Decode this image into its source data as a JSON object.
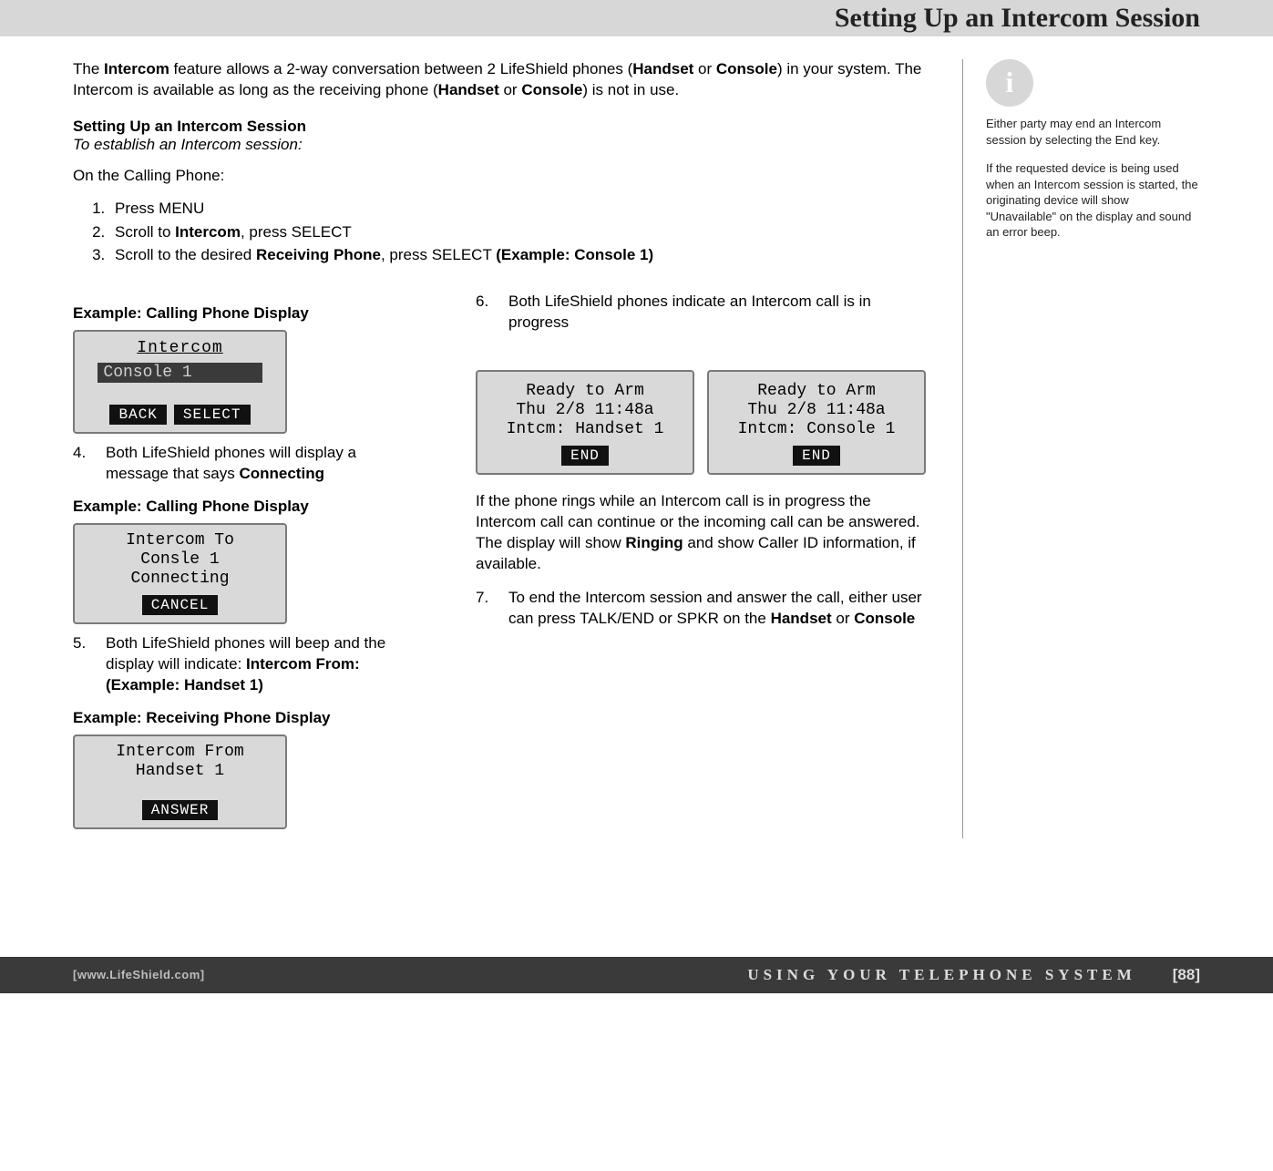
{
  "header": {
    "title": "Setting Up an Intercom Session"
  },
  "intro": {
    "part1": "The ",
    "b1": "Intercom",
    "part2": " feature allows a 2-way conversation between 2 LifeShield phones (",
    "b2": "Handset",
    "part3": " or ",
    "b3": "Console",
    "part4": ") in your system. The Intercom is available as long as the receiving phone (",
    "b4": "Handset",
    "part5": " or ",
    "b5": "Console",
    "part6": ") is not in use."
  },
  "subhead": "Setting Up an Intercom Session",
  "subhead_em": "To establish an Intercom session:",
  "on_calling": "On the Calling Phone:",
  "steps123": {
    "s1": "Press MENU",
    "s2a": "Scroll to ",
    "s2b": "Intercom",
    "s2c": ", press SELECT",
    "s3a": "Scroll to the desired ",
    "s3b": "Receiving Phone",
    "s3c": ", press SELECT ",
    "s3d": "(Example: Console 1)"
  },
  "ex_calling_label": "Example: Calling Phone Display",
  "ex_receiving_label": "Example: Receiving Phone Display",
  "lcd1": {
    "title": "Intercom",
    "item": "Console 1",
    "back": "BACK",
    "select": "SELECT"
  },
  "step4": {
    "num": "4.",
    "t1": "Both LifeShield phones will display a message that says ",
    "b": "Connecting"
  },
  "lcd2": {
    "l1": "Intercom To",
    "l2": "Consle 1",
    "l3": "Connecting",
    "cancel": "CANCEL"
  },
  "step5": {
    "num": "5.",
    "t1": "Both LifeShield phones will beep and the display will indicate: ",
    "b1": "Intercom From:",
    "b2": "(Example: Handset 1)"
  },
  "lcd3": {
    "l1": "Intercom From",
    "l2": "Handset 1",
    "answer": "ANSWER"
  },
  "step6": {
    "num": "6.",
    "t": "Both LifeShield phones indicate an Intercom call is in progress"
  },
  "lcd4": {
    "l1": "Ready to Arm",
    "l2": "Thu 2/8 11:48a",
    "l3": "Intcm: Handset 1",
    "end": "END"
  },
  "lcd5": {
    "l1": "Ready to Arm",
    "l2": "Thu 2/8 11:48a",
    "l3": "Intcm: Console 1",
    "end": "END"
  },
  "after6": {
    "t1": "If the phone rings while an Intercom call is in progress the Intercom call can continue or the incoming call can be answered. The display will show ",
    "b": "Ringing",
    "t2": " and show Caller ID information, if available."
  },
  "step7": {
    "num": "7.",
    "t1": "To end the Intercom session and answer the call, either user can press TALK/END or SPKR on the ",
    "b1": "Handset",
    "t2": " or ",
    "b2": "Console"
  },
  "sidebar": {
    "p1": "Either party may end an Intercom session by selecting the End key.",
    "p2": "If the requested device is being used when an Intercom session is started, the originating device will show \"Unavailable\" on the display and sound an error beep."
  },
  "footer": {
    "url": "[www.LifeShield.com]",
    "section": "USING YOUR TELEPHONE SYSTEM",
    "page": "[88]"
  }
}
